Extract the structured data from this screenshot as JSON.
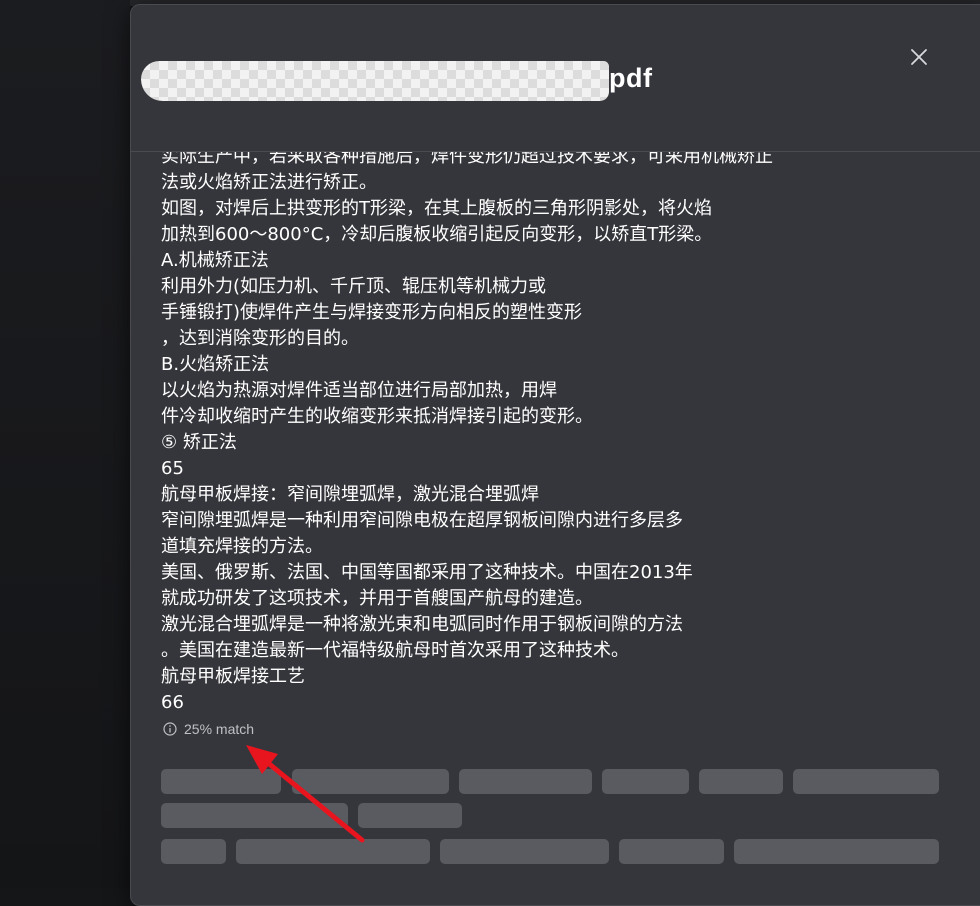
{
  "dialog": {
    "title": "pdf",
    "close_icon": "close-icon"
  },
  "document_lines": [
    "实际生产中，若采取各种措施后，焊件变形仍超过技术要求，可采用机械矫正",
    "法或火焰矫正法进行矫正。",
    "如图，对焊后上拱变形的T形梁，在其上腹板的三角形阴影处，将火焰",
    "加热到600～800°C，冷却后腹板收缩引起反向变形，以矫直T形梁。",
    "A.机械矫正法",
    "利用外力(如压力机、千斤顶、辊压机等机械力或",
    "手锤锻打)使焊件产生与焊接变形方向相反的塑性变形",
    "，达到消除变形的目的。",
    "B.火焰矫正法",
    "以火焰为热源对焊件适当部位进行局部加热，用焊",
    "件冷却收缩时产生的收缩变形来抵消焊接引起的变形。",
    "⑤ 矫正法",
    "65",
    "航母甲板焊接：窄间隙埋弧焊，激光混合埋弧焊",
    "窄间隙埋弧焊是一种利用窄间隙电极在超厚钢板间隙内进行多层多",
    "道填充焊接的方法。",
    "美国、俄罗斯、法国、中国等国都采用了这种技术。中国在2013年",
    "就成功研发了这项技术，并用于首艘国产航母的建造。",
    "激光混合埋弧焊是一种将激光束和电弧同时作用于钢板间隙的方法",
    "。美国在建造最新一代福特级航母时首次采用了这种技术。",
    "航母甲板焊接工艺",
    "66"
  ],
  "match": {
    "icon": "info-icon",
    "label": "25% match"
  },
  "colors": {
    "dialog_bg": "#35363b",
    "text": "#ffffff",
    "muted_text": "#bfc0c4",
    "chip_placeholder": "#5a5b60",
    "annotation_arrow": "#e8141e"
  }
}
